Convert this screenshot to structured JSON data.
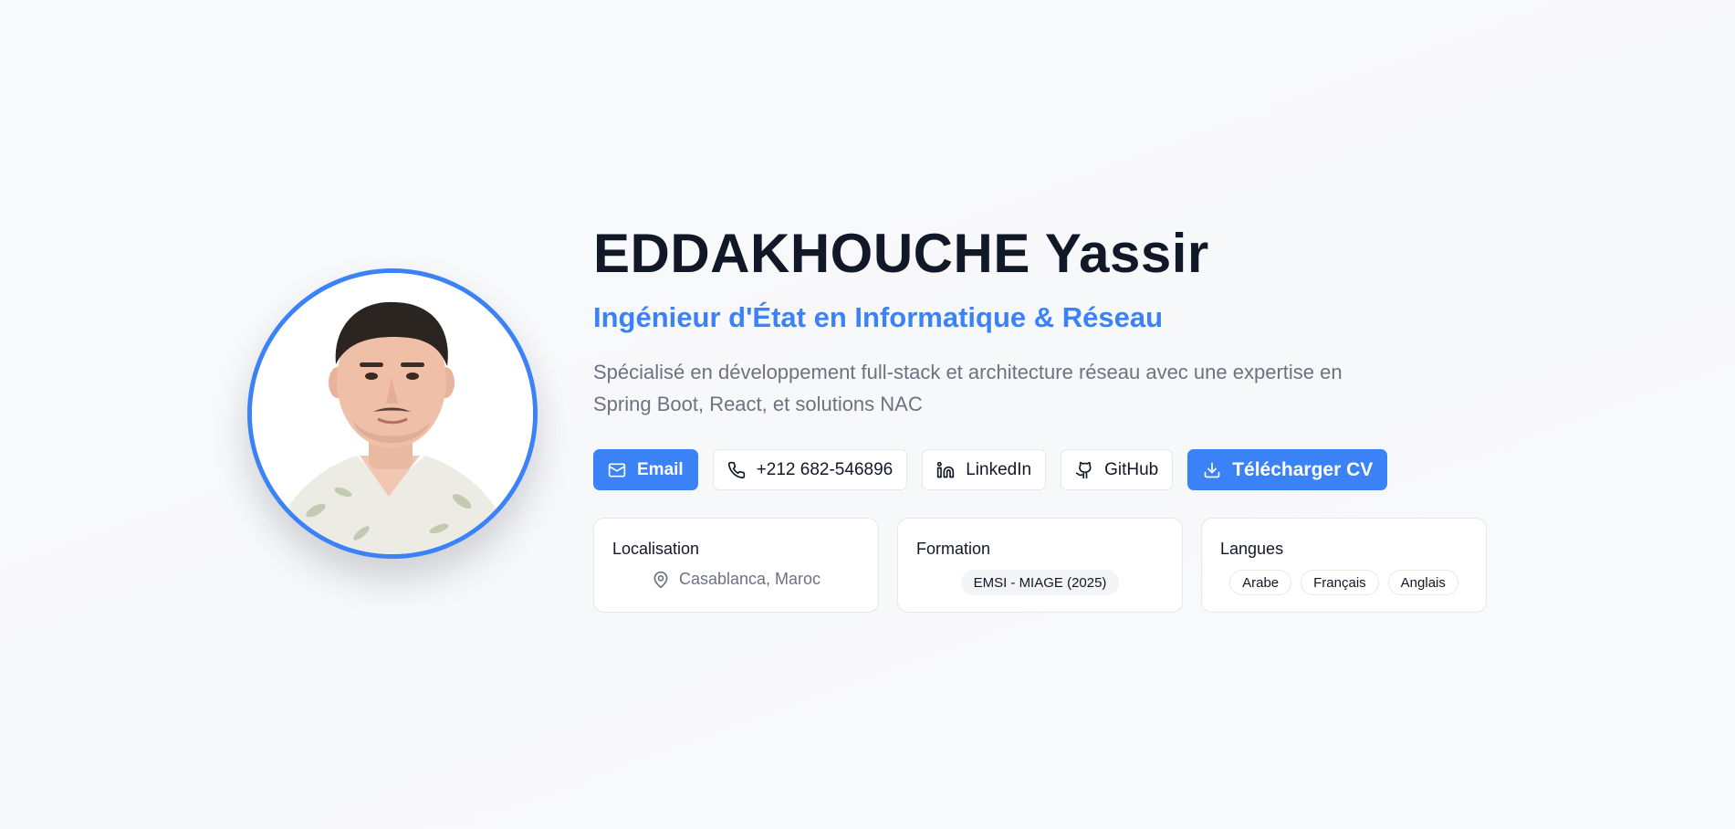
{
  "profile": {
    "name": "EDDAKHOUCHE Yassir",
    "role": "Ingénieur d'État en Informatique & Réseau",
    "description": "Spécialisé en développement full-stack et architecture réseau avec une expertise en Spring Boot, React, et solutions NAC"
  },
  "actions": {
    "email": {
      "label": "Email",
      "icon": "mail-icon"
    },
    "phone": {
      "label": "+212 682-546896",
      "icon": "phone-icon"
    },
    "linkedin": {
      "label": "LinkedIn",
      "icon": "linkedin-icon"
    },
    "github": {
      "label": "GitHub",
      "icon": "github-icon"
    },
    "cv": {
      "label": "Télécharger CV",
      "icon": "download-icon"
    }
  },
  "cards": {
    "location": {
      "title": "Localisation",
      "value": "Casablanca, Maroc",
      "icon": "map-pin-icon"
    },
    "education": {
      "title": "Formation",
      "value": "EMSI - MIAGE (2025)"
    },
    "languages": {
      "title": "Langues",
      "items": [
        "Arabe",
        "Français",
        "Anglais"
      ]
    }
  },
  "colors": {
    "accent": "#3b82f6",
    "text": "#111827",
    "muted": "#6b7280",
    "border": "#e5e7eb"
  }
}
